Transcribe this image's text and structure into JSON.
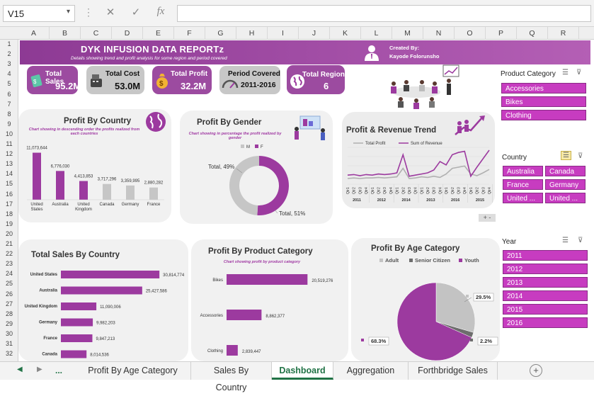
{
  "formula_bar": {
    "name_box": "V15",
    "cancel_glyph": "✕",
    "enter_glyph": "✓",
    "fx_glyph": "fx"
  },
  "columns": [
    "A",
    "B",
    "C",
    "D",
    "E",
    "F",
    "G",
    "H",
    "I",
    "J",
    "K",
    "L",
    "M",
    "N",
    "O",
    "P",
    "Q",
    "R"
  ],
  "rows": [
    "1",
    "2",
    "3",
    "4",
    "5",
    "6",
    "7",
    "8",
    "9",
    "10",
    "11",
    "12",
    "13",
    "14",
    "15",
    "16",
    "17",
    "18",
    "19",
    "20",
    "21",
    "22",
    "23",
    "24",
    "25",
    "26",
    "27",
    "28",
    "29",
    "30",
    "31",
    "32"
  ],
  "banner": {
    "title": "DYK INFUSION DATA REPORTz",
    "subtitle": "Details showing trend and profit analysis for some region and period covered",
    "created_by": "Created By:",
    "author": "Kayode Folorunsho"
  },
  "kpis": {
    "total_sales": {
      "label": "Total Sales",
      "value": "95.2M"
    },
    "total_cost": {
      "label": "Total Cost",
      "value": "53.0M"
    },
    "total_profit": {
      "label": "Total Profit",
      "value": "32.2M"
    },
    "period": {
      "label": "Period Covered",
      "value": "2011-2016"
    },
    "region": {
      "label": "Total Region",
      "value": "6"
    }
  },
  "colors": {
    "purple": "#9c3a9f",
    "gray": "#c8c8c8",
    "slicer": "#c73cc0",
    "accent_green": "#217346"
  },
  "panels": {
    "country": {
      "title": "Profit By Country",
      "subtitle": "Chart showing in descending order the profits realized from each countries"
    },
    "gender": {
      "title": "Profit By Gender",
      "subtitle": "Chart showing in percentage the profit realized by gender",
      "legend_m": "M",
      "legend_f": "F",
      "label_a": "Total, 49%",
      "label_b": "Total, 51%"
    },
    "trend": {
      "title": "Profit & Revenue Trend",
      "legend_profit": "Total Profit",
      "legend_revenue": "Sum of Revenue",
      "zoom": "+ -"
    },
    "sales_country": {
      "title": "Total Sales By Country"
    },
    "product": {
      "title": "Profit By Product Category",
      "subtitle": "Chart showing profit by product category"
    },
    "age": {
      "title": "Profit By Age Category",
      "legend_adult": "Adult",
      "legend_senior": "Senior Citizen",
      "legend_youth": "Youth",
      "label_adult": "29.5%",
      "label_senior": "2.2%",
      "label_youth": "68.3%"
    }
  },
  "chart_data": [
    {
      "type": "bar",
      "title": "Profit By Country",
      "categories": [
        "United States",
        "Australia",
        "United Kingdom",
        "Canada",
        "Germany",
        "France"
      ],
      "values": [
        11073644,
        6776030,
        4413853,
        3717296,
        3359995,
        2880282
      ],
      "value_labels": [
        "11,073,644",
        "6,776,030",
        "4,413,853",
        "3,717,296",
        "3,359,995",
        "2,880,282"
      ],
      "ylim": [
        0,
        12000000
      ]
    },
    {
      "type": "pie",
      "title": "Profit By Gender",
      "categories": [
        "M",
        "F"
      ],
      "values": [
        49,
        51
      ],
      "donut": true
    },
    {
      "type": "line",
      "title": "Profit & Revenue Trend",
      "x_years": [
        "2011",
        "2012",
        "2014",
        "2013",
        "2016",
        "2015"
      ],
      "quarter_labels": [
        "Qtr1",
        "Qtr2",
        "Qtr3",
        "Qtr4"
      ],
      "series": [
        {
          "name": "Total Profit",
          "color": "#b0b0b0",
          "values": [
            10,
            11,
            10,
            11,
            11,
            12,
            11,
            12,
            13,
            28,
            10,
            11,
            13,
            12,
            14,
            12,
            18,
            28,
            30,
            32,
            18,
            15,
            20,
            26
          ]
        },
        {
          "name": "Sum of Revenue",
          "color": "#9c3a9f",
          "values": [
            16,
            17,
            15,
            17,
            16,
            18,
            17,
            18,
            20,
            52,
            14,
            16,
            18,
            20,
            25,
            40,
            34,
            52,
            56,
            58,
            14,
            30,
            45,
            60
          ]
        }
      ],
      "ylim": [
        0,
        65
      ]
    },
    {
      "type": "bar",
      "orientation": "horizontal",
      "title": "Total Sales By Country",
      "categories": [
        "United States",
        "Australia",
        "United Kingdom",
        "Germany",
        "France",
        "Canada"
      ],
      "values": [
        30814774,
        25427586,
        11090006,
        9982203,
        9847213,
        8014536
      ],
      "value_labels": [
        "30,814,774",
        "25,427,586",
        "11,090,006",
        "9,982,203",
        "9,847,213",
        "8,014,536"
      ],
      "xlim": [
        0,
        31000000
      ]
    },
    {
      "type": "bar",
      "orientation": "horizontal",
      "title": "Profit By Product Category",
      "categories": [
        "Bikes",
        "Accessories",
        "Clothing"
      ],
      "values": [
        20519276,
        8862377,
        2839447
      ],
      "value_labels": [
        "20,519,276",
        "8,862,377",
        "2,839,447"
      ],
      "xlim": [
        0,
        21000000
      ]
    },
    {
      "type": "pie",
      "title": "Profit By Age Category",
      "categories": [
        "Adult",
        "Senior Citizen",
        "Youth"
      ],
      "values": [
        29.5,
        2.2,
        68.3
      ],
      "colors": [
        "#c3c3c3",
        "#6d6d6d",
        "#9c3a9f"
      ]
    }
  ],
  "slicers": {
    "product": {
      "header": "Product Category",
      "items": [
        "Accessories",
        "Bikes",
        "Clothing"
      ]
    },
    "country": {
      "header": "Country",
      "items": [
        "Australia",
        "Canada",
        "France",
        "Germany",
        "United ...",
        "United ..."
      ]
    },
    "year": {
      "header": "Year",
      "items": [
        "2011",
        "2012",
        "2013",
        "2014",
        "2015",
        "2016"
      ]
    }
  },
  "tabs": {
    "dots": "...",
    "items": [
      "Profit By Age Category",
      "Sales By Country",
      "Dashboard",
      "Aggregation",
      "Forthbridge Sales"
    ],
    "active": "Dashboard",
    "add": "+"
  }
}
